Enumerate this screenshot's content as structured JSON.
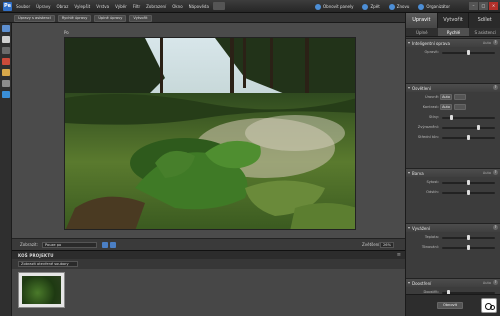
{
  "app": {
    "menu": [
      "Soubor",
      "Úpravy",
      "Obraz",
      "Vylepšit",
      "Vrstva",
      "Výběr",
      "Filtr",
      "Zobrazení",
      "Okno",
      "Nápověda"
    ],
    "top_actions": [
      {
        "label": "Obnovit panely",
        "icon": "refresh-icon",
        "color": "#4c8ed6"
      },
      {
        "label": "Zpět",
        "icon": "undo-icon",
        "color": "#4c8ed6"
      },
      {
        "label": "Znovu",
        "icon": "redo-icon",
        "color": "#4c8ed6"
      },
      {
        "label": "Organizátor",
        "icon": "organizer-icon",
        "color": "#4c8ed6"
      }
    ]
  },
  "doc_tabs": [
    "Úpravy s asistencí",
    "Rychlé úpravy",
    "Úplné úpravy",
    "Vytvořit"
  ],
  "panel_tabs": [
    {
      "label": "Upravit",
      "active": true
    },
    {
      "label": "Vytvořit",
      "active": false
    },
    {
      "label": "Sdílet",
      "active": false
    }
  ],
  "mode_tabs": [
    {
      "label": "Úplné",
      "active": false
    },
    {
      "label": "Rychlé",
      "active": true
    },
    {
      "label": "S asistencí",
      "active": false
    }
  ],
  "canvas": {
    "label": "Po",
    "zoom_label": "Zobrazit:",
    "zoom_value": "Pouze po",
    "view_label": "Zvětšení:",
    "view_value": "26%"
  },
  "project_bin": {
    "title": "KOŠ PROJEKTU",
    "filter": "Zobrazit otevřené soubory"
  },
  "panel": {
    "sections": [
      {
        "title": "Inteligentní oprava",
        "extra": "Auto",
        "rows": [
          {
            "label": "Opravit:",
            "type": "slider",
            "value": 0.5
          }
        ]
      },
      {
        "title": "Osvětlení",
        "extra": "",
        "rows": [
          {
            "label": "Úrovně:",
            "type": "buttons",
            "buttons": [
              "Auto",
              ""
            ]
          },
          {
            "label": "Kontrast:",
            "type": "buttons",
            "buttons": [
              "Auto",
              ""
            ]
          },
          {
            "label": "Stíny:",
            "type": "slider",
            "value": 0.15
          },
          {
            "label": "Zvýraznění:",
            "type": "slider",
            "value": 0.7
          },
          {
            "label": "Střední tón:",
            "type": "slider",
            "value": 0.5
          }
        ]
      },
      {
        "title": "Barva",
        "extra": "Auto",
        "rows": [
          {
            "label": "Sytost:",
            "type": "slider",
            "value": 0.5
          },
          {
            "label": "Odstín:",
            "type": "slider",
            "value": 0.5
          }
        ]
      },
      {
        "title": "Vyvážení",
        "extra": "",
        "rows": [
          {
            "label": "Teplota:",
            "type": "slider",
            "value": 0.5
          },
          {
            "label": "Tónování:",
            "type": "slider",
            "value": 0.5
          }
        ]
      },
      {
        "title": "Doostření",
        "extra": "Auto",
        "rows": [
          {
            "label": "Doostřit:",
            "type": "slider",
            "value": 0.1
          }
        ]
      }
    ],
    "reset_label": "Obnovit"
  }
}
